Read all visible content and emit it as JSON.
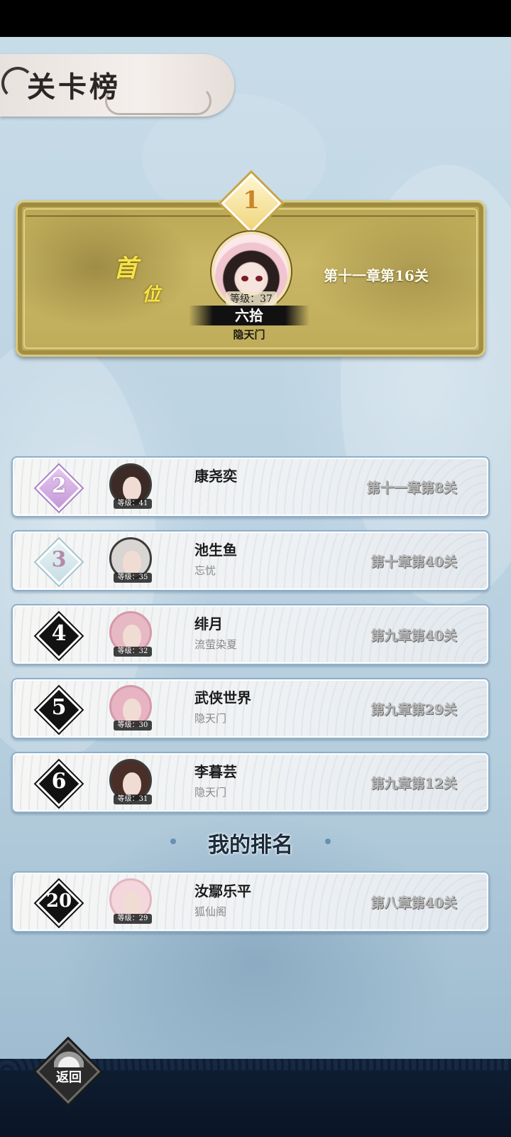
{
  "title": "关卡榜",
  "first_place": {
    "rank": "1",
    "badge": "首位",
    "level_label": "等级：37",
    "name": "六拾",
    "guild": "隐天门",
    "progress": "第十一章第16关"
  },
  "rows": [
    {
      "rank": "2",
      "level_label": "等级：41",
      "name": "康尧奕",
      "guild": "",
      "progress": "第十一章第8关"
    },
    {
      "rank": "3",
      "level_label": "等级：35",
      "name": "池生鱼",
      "guild": "忘忧",
      "progress": "第十章第40关"
    },
    {
      "rank": "4",
      "level_label": "等级：32",
      "name": "绯月",
      "guild": "流萤染夏",
      "progress": "第九章第40关"
    },
    {
      "rank": "5",
      "level_label": "等级：30",
      "name": "武侠世界",
      "guild": "隐天门",
      "progress": "第九章第29关"
    },
    {
      "rank": "6",
      "level_label": "等级：31",
      "name": "李暮芸",
      "guild": "隐天门",
      "progress": "第九章第12关"
    }
  ],
  "my_rank_title": "我的排名",
  "my_rank": {
    "rank": "20",
    "level_label": "等级：29",
    "name": "汝鄢乐平",
    "guild": "狐仙阁",
    "progress": "第八章第40关"
  },
  "back_label": "返回",
  "colors": {
    "gold": "#c9b765",
    "row_border": "#8db0ca",
    "rank2": "#c399d9",
    "rank3": "#c7dde4",
    "rank_other": "#121212"
  }
}
